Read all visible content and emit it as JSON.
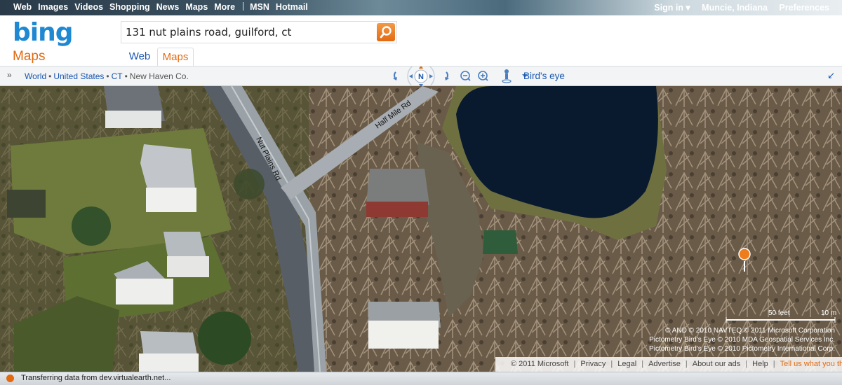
{
  "topbar": {
    "nav": [
      "Web",
      "Images",
      "Videos",
      "Shopping",
      "News",
      "Maps",
      "More"
    ],
    "services": [
      "MSN",
      "Hotmail"
    ],
    "sign_in": "Sign in ▾",
    "location": "Muncie, Indiana",
    "preferences": "Preferences"
  },
  "header": {
    "logo": "bing",
    "logo_sub": "Maps",
    "search_value": "131 nut plains road, guilford, ct",
    "tabs": [
      "Web",
      "Maps"
    ],
    "active_tab": "Maps"
  },
  "toolbar": {
    "breadcrumb": [
      "World",
      "United States",
      "CT",
      "New Haven Co."
    ],
    "compass": "N",
    "view_mode": "Bird's eye"
  },
  "map": {
    "road_labels": [
      "Nut Plains Rd",
      "Half Mile Rd"
    ],
    "scale": [
      "50 feet",
      "10 m"
    ],
    "copyright": [
      "© AND   © 2010 NAVTEQ   © 2011 Microsoft Corporation",
      "Pictometry Bird's Eye © 2010 MDA Geospatial Services Inc.",
      "Pictometry Bird's Eye © 2010 Pictometry International Corp."
    ]
  },
  "footer": {
    "copyright": "© 2011 Microsoft",
    "links": [
      "Privacy",
      "Legal",
      "Advertise",
      "About our ads",
      "Help"
    ],
    "feedback": "Tell us what you think"
  },
  "status": {
    "text": "Transferring data from dev.virtualearth.net..."
  },
  "colors": {
    "brand_blue": "#1e88d2",
    "accent_orange": "#e36a10",
    "link_blue": "#1a56b0"
  }
}
